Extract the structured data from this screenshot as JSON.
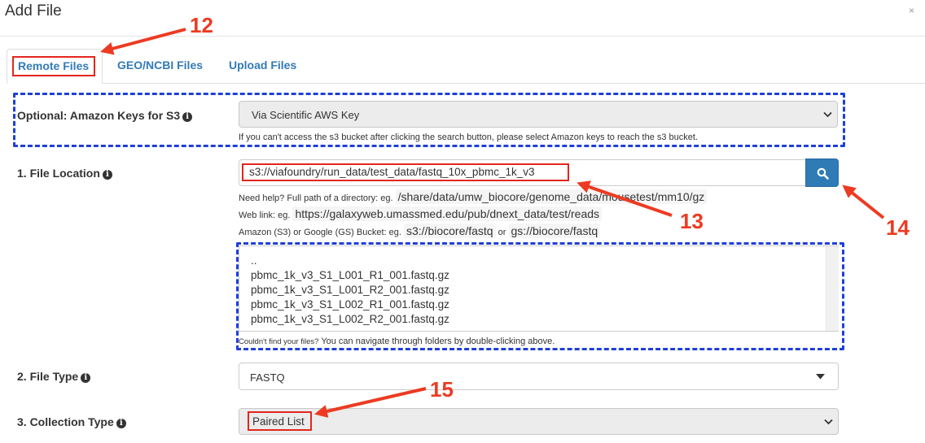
{
  "dialog": {
    "title": "Add File",
    "close_label": "×"
  },
  "tabs": [
    {
      "label": "Remote Files",
      "active": true
    },
    {
      "label": "GEO/NCBI Files",
      "active": false
    },
    {
      "label": "Upload Files",
      "active": false
    }
  ],
  "amazon_keys": {
    "label": "Optional: Amazon Keys for S3",
    "selected": "Via Scientific AWS Key",
    "help": "If you can't access the s3 bucket after clicking the search button, please select Amazon keys to reach the s3 bucket."
  },
  "file_location": {
    "label": "1. File Location",
    "value": "s3://viafoundry/run_data/test_data/fastq_10x_pbmc_1k_v3",
    "help_dir_prefix": "Need help? Full path of a directory: eg.",
    "help_dir_example": "/share/data/umw_biocore/genome_data/mousetest/mm10/gz",
    "help_web_prefix": "Web link: eg.",
    "help_web_example": "https://galaxyweb.umassmed.edu/pub/dnext_data/test/reads",
    "help_bucket_prefix": "Amazon (S3) or Google (GS) Bucket: eg.",
    "help_bucket_example1": "s3://biocore/fastq",
    "help_bucket_or": "or",
    "help_bucket_example2": "gs://biocore/fastq"
  },
  "file_list": {
    "items": [
      "..",
      "pbmc_1k_v3_S1_L001_R1_001.fastq.gz",
      "pbmc_1k_v3_S1_L001_R2_001.fastq.gz",
      "pbmc_1k_v3_S1_L002_R1_001.fastq.gz",
      "pbmc_1k_v3_S1_L002_R2_001.fastq.gz"
    ],
    "help_small": "Couldn't find your files?",
    "help_rest": "You can navigate through folders by double-clicking above."
  },
  "file_type": {
    "label": "2. File Type",
    "selected": "FASTQ"
  },
  "collection_type": {
    "label": "3. Collection Type",
    "selected": "Paired List"
  },
  "annotations": {
    "n12": "12",
    "n13": "13",
    "n14": "14",
    "n15": "15"
  },
  "colors": {
    "annotation_red": "#ec3b22",
    "annotation_blue": "#1f3fd9",
    "link_blue": "#337ab7",
    "button_blue": "#2f7bb6"
  },
  "icons": {
    "info": "info-circle-icon",
    "search": "search-icon",
    "select_caret": "chevron-down-icon",
    "dropdown_caret": "caret-down-icon"
  }
}
